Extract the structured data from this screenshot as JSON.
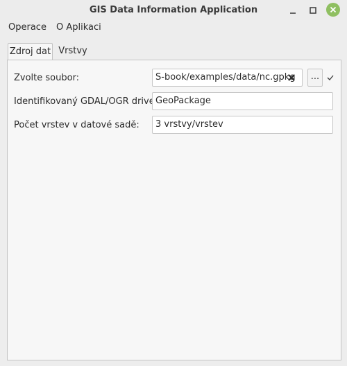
{
  "window": {
    "title": "GIS Data Information Application"
  },
  "menubar": {
    "items": [
      "Operace",
      "O Aplikaci"
    ]
  },
  "tabs": [
    {
      "label": "Zdroj dat",
      "active": true
    },
    {
      "label": "Vrstvy",
      "active": false
    }
  ],
  "form": {
    "file": {
      "label": "Zvolte soubor:",
      "value": "S-book/examples/data/nc.gpkg",
      "browse_label": "..."
    },
    "driver": {
      "label": "Identifikovaný GDAL/OGR driver:",
      "value": "GeoPackage"
    },
    "layers": {
      "label": "Počet vrstev v datové sadě:",
      "value": "3 vrstvy/vrstev"
    }
  },
  "icons": {
    "minimize": "minimize-icon",
    "maximize": "maximize-icon",
    "close": "close-icon",
    "clear": "clear-icon",
    "check": "check-icon"
  },
  "colors": {
    "close_button": "#8fbf61",
    "panel_bg": "#f7f7f7",
    "window_bg": "#ededed"
  }
}
